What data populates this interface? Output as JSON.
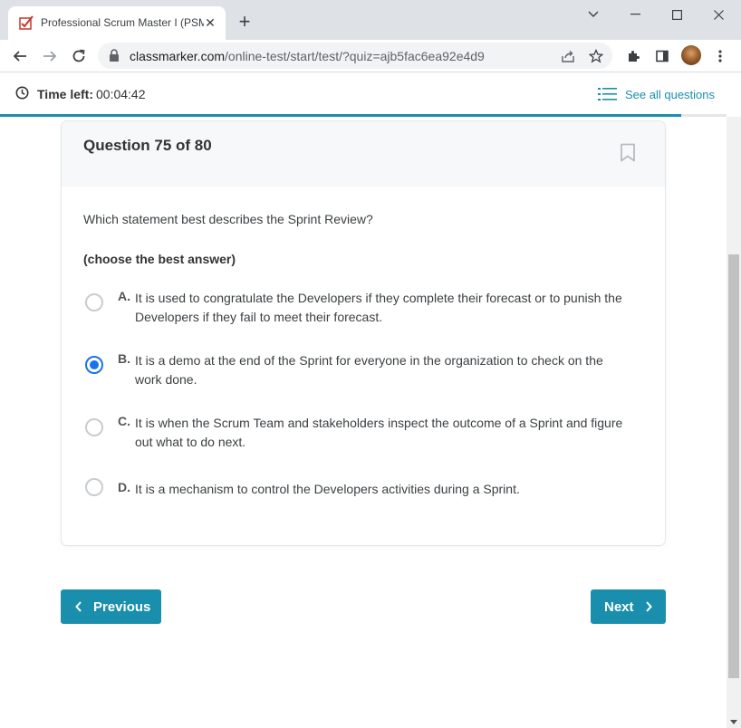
{
  "browser": {
    "tab_title": "Professional Scrum Master I (PSM",
    "url_domain": "classmarker.com",
    "url_path": "/online-test/start/test/?quiz=ajb5fac6ea92e4d9"
  },
  "header": {
    "time_label": "Time left:",
    "time_value": "00:04:42",
    "see_all_label": "See all questions"
  },
  "progress": {
    "fraction": 0.9375
  },
  "question": {
    "number_label": "Question 75 of 80",
    "text": "Which statement best describes the Sprint Review?",
    "hint": "(choose the best answer)",
    "options": [
      {
        "letter": "A.",
        "text": "It is used to congratulate the Developers if they complete their forecast or to punish the Developers if they fail to meet their forecast.",
        "selected": false
      },
      {
        "letter": "B.",
        "text": "It is a demo at the end of the Sprint for everyone in the organization to check on the work done.",
        "selected": true
      },
      {
        "letter": "C.",
        "text": "It is when the Scrum Team and stakeholders inspect the outcome of a Sprint and figure out what to do next.",
        "selected": false
      },
      {
        "letter": "D.",
        "text": "It is a mechanism to control the Developers activities during a Sprint.",
        "selected": false
      }
    ]
  },
  "nav": {
    "previous_label": "Previous",
    "next_label": "Next"
  },
  "colors": {
    "accent": "#1a8fad",
    "radio_selected": "#1a73e8"
  }
}
